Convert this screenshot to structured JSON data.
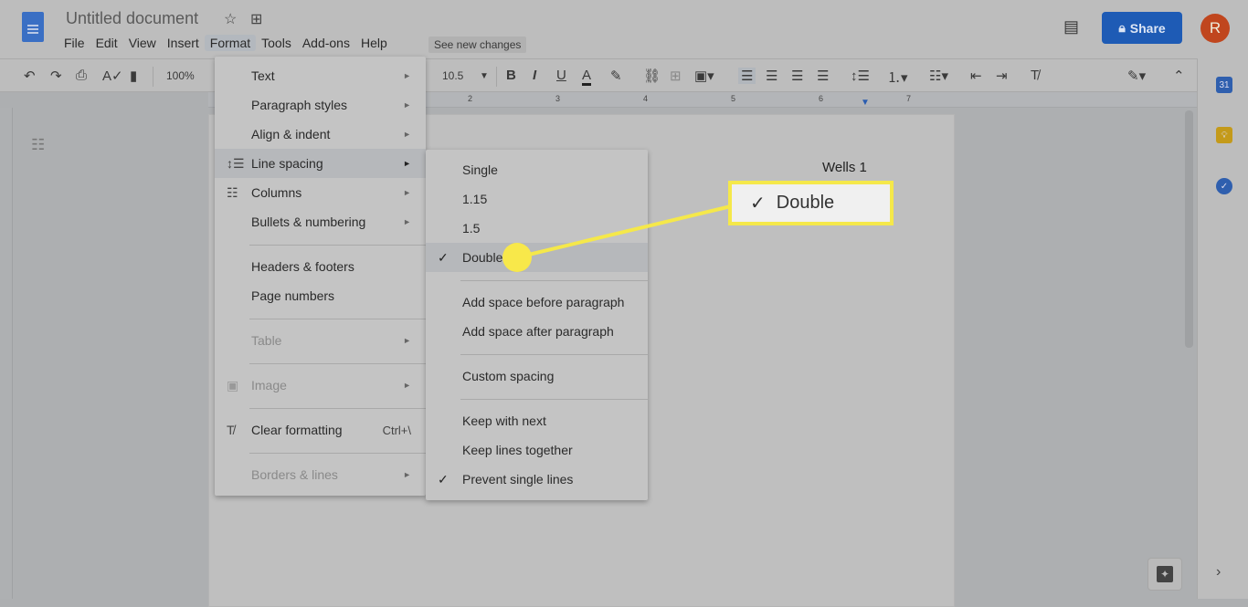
{
  "header": {
    "title": "Untitled document",
    "menus": [
      "File",
      "Edit",
      "View",
      "Insert",
      "Format",
      "Tools",
      "Add-ons",
      "Help"
    ],
    "active_menu": "Format",
    "see_new_changes": "See new changes",
    "share_label": "Share",
    "avatar_letter": "R",
    "share_color": "#1e5bb5"
  },
  "toolbar": {
    "zoom": "100%",
    "font_size": "10.5"
  },
  "ruler": {
    "ticks": [
      "1",
      "2",
      "3",
      "4",
      "5",
      "6",
      "7"
    ]
  },
  "document": {
    "header_text": "Wells 1"
  },
  "format_menu": {
    "items": [
      {
        "label": "Text",
        "submenu": true
      },
      {
        "label": "Paragraph styles",
        "submenu": true
      },
      {
        "label": "Align & indent",
        "submenu": true
      },
      {
        "label": "Line spacing",
        "submenu": true,
        "highlighted": true
      },
      {
        "label": "Columns",
        "submenu": true
      },
      {
        "label": "Bullets & numbering",
        "submenu": true
      },
      {
        "label": "Headers & footers"
      },
      {
        "label": "Page numbers"
      },
      {
        "label": "Table",
        "submenu": true,
        "disabled": true
      },
      {
        "label": "Image",
        "submenu": true,
        "disabled": true
      },
      {
        "label": "Clear formatting",
        "shortcut": "Ctrl+\\"
      },
      {
        "label": "Borders & lines",
        "submenu": true,
        "disabled": true
      }
    ]
  },
  "line_spacing_menu": {
    "items": [
      {
        "label": "Single"
      },
      {
        "label": "1.15"
      },
      {
        "label": "1.5"
      },
      {
        "label": "Double",
        "checked": true
      },
      {
        "label": "Add space before paragraph"
      },
      {
        "label": "Add space after paragraph"
      },
      {
        "label": "Custom spacing"
      },
      {
        "label": "Keep with next"
      },
      {
        "label": "Keep lines together"
      },
      {
        "label": "Prevent single lines",
        "checked": true
      }
    ]
  },
  "callout": {
    "label": "Double",
    "highlight_color": "#f5e84a"
  }
}
